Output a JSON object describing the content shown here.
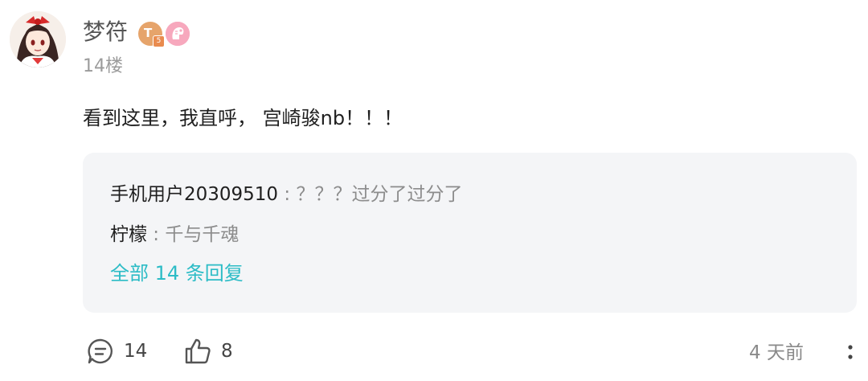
{
  "post": {
    "username": "梦符",
    "floor": "14楼",
    "content": "看到这里，我直呼， 宫崎骏nb！！！",
    "badges": {
      "level_letter": "T",
      "level_number": "5"
    }
  },
  "replies": {
    "items": [
      {
        "author": "手机用户20309510",
        "separator": " : ",
        "text": "？？？过分了过分了"
      },
      {
        "author": "柠檬",
        "separator": " : ",
        "text": "千与千魂"
      }
    ],
    "more_label": "全部 14 条回复"
  },
  "actions": {
    "comment_count": "14",
    "like_count": "8",
    "time": "4 天前"
  },
  "colors": {
    "accent": "#2cbcc6",
    "reply_bg": "#f4f5f7",
    "muted": "#8c8c8c"
  },
  "icons": [
    "avatar-image",
    "level-badge-icon",
    "fan-badge-icon",
    "comment-icon",
    "like-icon",
    "more-menu-icon"
  ]
}
